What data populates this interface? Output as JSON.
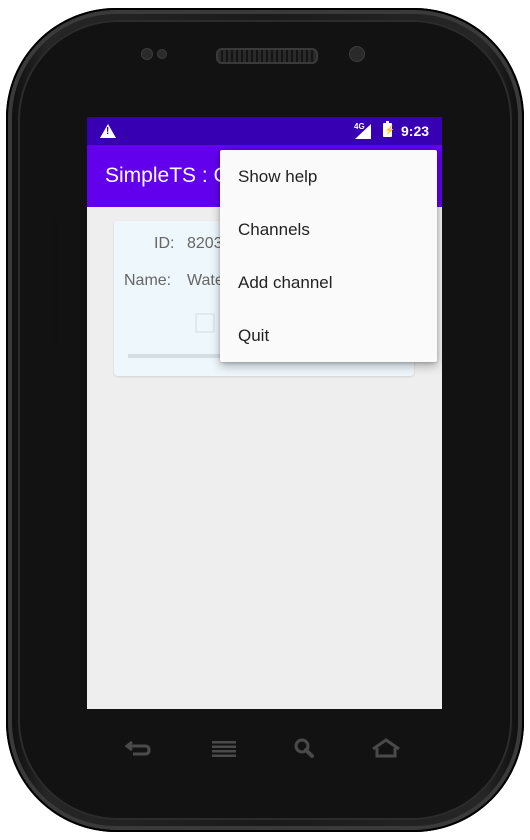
{
  "status_bar": {
    "network_badge": "4G",
    "time": "9:23",
    "icons": [
      "warning-icon",
      "signal-icon",
      "battery-charging-icon"
    ]
  },
  "app_bar": {
    "title": "SimpleTS : C"
  },
  "channel_card": {
    "id_label": "ID:",
    "id_value": "8203",
    "name_label": "Name:",
    "name_value": "Wate"
  },
  "overflow_menu": {
    "items": [
      {
        "label": "Show help"
      },
      {
        "label": "Channels"
      },
      {
        "label": "Add channel"
      },
      {
        "label": "Quit"
      }
    ]
  },
  "nav_bar": {
    "icons": [
      "back-icon",
      "menu-icon",
      "search-icon",
      "home-icon"
    ]
  },
  "colors": {
    "status_bar": "#3700b3",
    "app_bar": "#6200ee",
    "screen_background": "#eeeeee",
    "card_background": "#eef7fc",
    "menu_background": "#fafafa"
  }
}
